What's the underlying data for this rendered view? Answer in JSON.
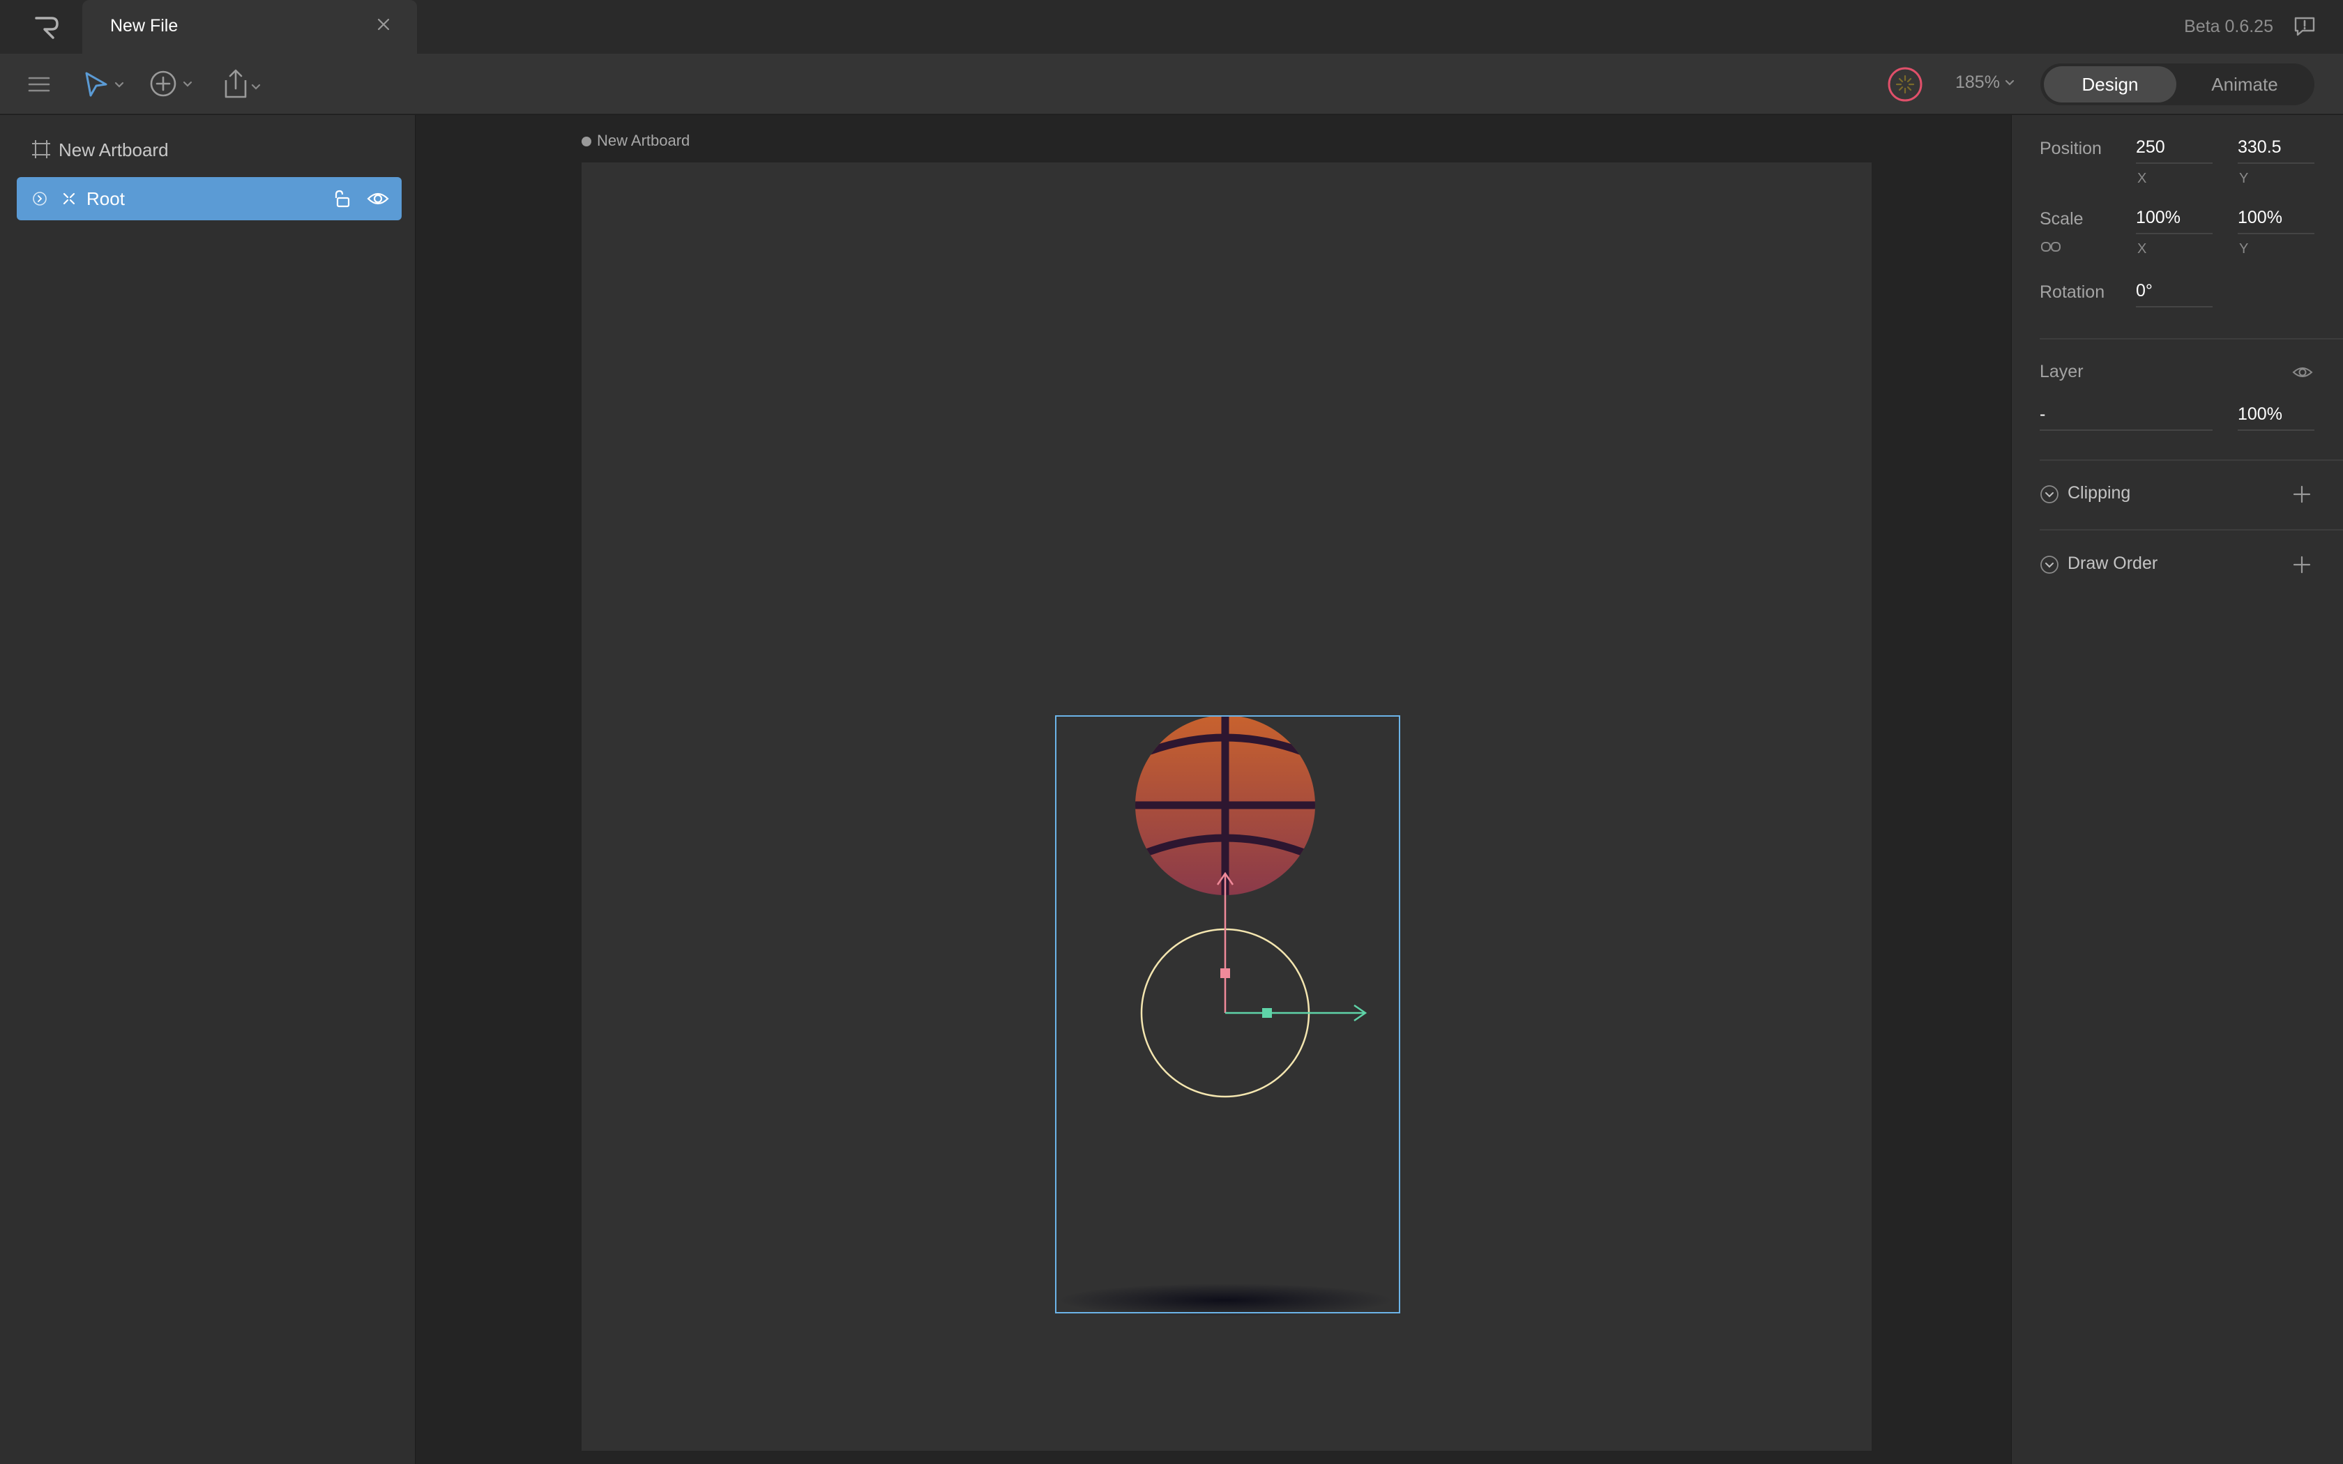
{
  "titlebar": {
    "tab_title": "New File",
    "version": "Beta 0.6.25",
    "icons": [
      "rive-logo-icon",
      "close-icon",
      "feedback-icon"
    ]
  },
  "toolbar": {
    "zoom": "185%",
    "modes": {
      "design": "Design",
      "animate": "Animate",
      "active": "Design"
    },
    "icons": [
      "menu-icon",
      "select-tool-icon",
      "add-tool-icon",
      "export-tool-icon",
      "status-indicator-icon"
    ]
  },
  "hierarchy": {
    "artboard_label": "New Artboard",
    "root_label": "Root"
  },
  "canvas": {
    "artboard_title": "New Artboard"
  },
  "inspector": {
    "position": {
      "label": "Position",
      "x": "250",
      "y": "330.5",
      "x_axis": "X",
      "y_axis": "Y"
    },
    "scale": {
      "label": "Scale",
      "x": "100%",
      "y": "100%",
      "x_axis": "X",
      "y_axis": "Y"
    },
    "rotation": {
      "label": "Rotation",
      "value": "0°"
    },
    "layer": {
      "label": "Layer",
      "blend": "-",
      "opacity": "100%"
    },
    "clipping": {
      "label": "Clipping"
    },
    "draw_order": {
      "label": "Draw Order"
    }
  },
  "colors": {
    "accent_blue": "#5b9bd5",
    "selection_box": "#6cb4e8",
    "x_axis": "#5fd4a8",
    "y_axis": "#f08a9a",
    "rotate_ring": "#f4e6b0",
    "ball": "#c8622e",
    "ball_lines": "#2d1630",
    "status_ring": "#e0506a"
  }
}
